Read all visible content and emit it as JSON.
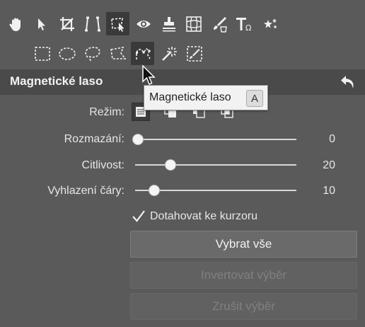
{
  "toolbar_top": {
    "items": [
      {
        "name": "hand-tool-icon",
        "active": false
      },
      {
        "name": "arrow-select-icon",
        "active": false
      },
      {
        "name": "crop-icon",
        "active": false
      },
      {
        "name": "perspective-icon",
        "active": false
      },
      {
        "name": "selection-tool-icon",
        "active": true
      },
      {
        "name": "eye-icon",
        "active": false
      },
      {
        "name": "clone-stamp-icon",
        "active": false
      },
      {
        "name": "grid-warp-icon",
        "active": false
      },
      {
        "name": "brush-bucket-icon",
        "active": false
      },
      {
        "name": "text-tool-icon",
        "active": false
      },
      {
        "name": "effects-stars-icon",
        "active": false
      }
    ]
  },
  "toolbar_select": {
    "items": [
      {
        "name": "rect-select-icon",
        "active": false
      },
      {
        "name": "ellipse-select-icon",
        "active": false
      },
      {
        "name": "lasso-icon",
        "active": false
      },
      {
        "name": "polygon-lasso-icon",
        "active": false
      },
      {
        "name": "magnetic-lasso-icon",
        "active": true
      },
      {
        "name": "magic-wand-icon",
        "active": false
      },
      {
        "name": "mask-brush-icon",
        "active": false
      }
    ]
  },
  "panel": {
    "title": "Magnetické laso",
    "mode_label": "Režim:",
    "mode_selected": 0,
    "sliders": [
      {
        "label": "Rozmazání:",
        "value": "0",
        "fraction": 0.0
      },
      {
        "label": "Citlivost:",
        "value": "20",
        "fraction": 0.2
      },
      {
        "label": "Vyhlazení čáry:",
        "value": "10",
        "fraction": 0.1
      }
    ],
    "checkbox_label": "Dotahovat ke kurzoru",
    "checkbox_checked": true,
    "buttons": [
      {
        "label": "Vybrat vše",
        "enabled": true
      },
      {
        "label": "Invertovat výběr",
        "enabled": false
      },
      {
        "label": "Zrušit výběr",
        "enabled": false
      }
    ]
  },
  "tooltip": {
    "text": "Magnetické laso",
    "shortcut": "A"
  }
}
